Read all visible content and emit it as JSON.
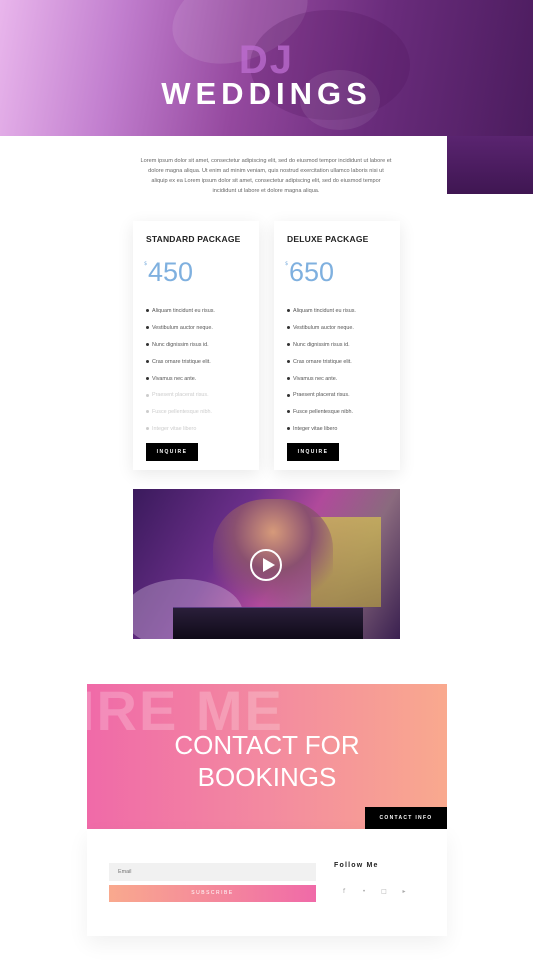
{
  "hero": {
    "overlay_word": "DJ",
    "title": "WEDDINGS"
  },
  "intro": {
    "text": "Lorem ipsum dolor sit amet, consectetur adipiscing elit, sed do eiusmod tempor incididunt ut labore et dolore magna aliqua. Ut enim ad minim veniam, quis nostrud exercitation ullamco laboris nisi ut aliquip ex ea Lorem ipsum dolor sit amet, consectetur adipiscing elit, sed do eiusmod tempor incididunt ut labore et dolore magna aliqua."
  },
  "pricing": [
    {
      "name": "STANDARD PACKAGE",
      "currency": "$",
      "price": "450",
      "features": [
        {
          "text": "Aliquam tincidunt eu risus.",
          "included": true
        },
        {
          "text": "Vestibulum auctor neque.",
          "included": true
        },
        {
          "text": "Nunc dignissim risus id.",
          "included": true
        },
        {
          "text": "Cras ornare tristique elit.",
          "included": true
        },
        {
          "text": "Vivamus nec ante.",
          "included": true
        },
        {
          "text": "Praesent placerat risus.",
          "included": false
        },
        {
          "text": "Fusce pellentesque nibh.",
          "included": false
        },
        {
          "text": "Integer vitae libero",
          "included": false
        }
      ],
      "button": "INQUIRE"
    },
    {
      "name": "DELUXE PACKAGE",
      "currency": "$",
      "price": "650",
      "features": [
        {
          "text": "Aliquam tincidunt eu risus.",
          "included": true
        },
        {
          "text": "Vestibulum auctor neque.",
          "included": true
        },
        {
          "text": "Nunc dignissim risus id.",
          "included": true
        },
        {
          "text": "Cras ornare tristique elit.",
          "included": true
        },
        {
          "text": "Vivamus nec ante.",
          "included": true
        },
        {
          "text": "Praesent placerat risus.",
          "included": true
        },
        {
          "text": "Fusce pellentesque nibh.",
          "included": true
        },
        {
          "text": "Integer vitae libero",
          "included": true
        }
      ],
      "button": "INQUIRE"
    }
  ],
  "video": {
    "play_icon": "play-icon"
  },
  "contact": {
    "ghost_text": "IRE ME",
    "title_line1": "CONTACT FOR",
    "title_line2": "BOOKINGS",
    "button": "CONTACT INFO"
  },
  "subscribe": {
    "email_placeholder": "Email",
    "button": "SUBSCRIBE"
  },
  "follow": {
    "title": "Follow Me",
    "icons": [
      "facebook-icon",
      "twitter-icon",
      "instagram-icon",
      "youtube-icon"
    ],
    "glyphs": [
      "f",
      "•",
      "□",
      "▸"
    ]
  },
  "colors": {
    "price_accent": "#7fb0df",
    "pink": "#f06aa8",
    "peach": "#f9a98e",
    "purple": "#6a2c7c"
  }
}
